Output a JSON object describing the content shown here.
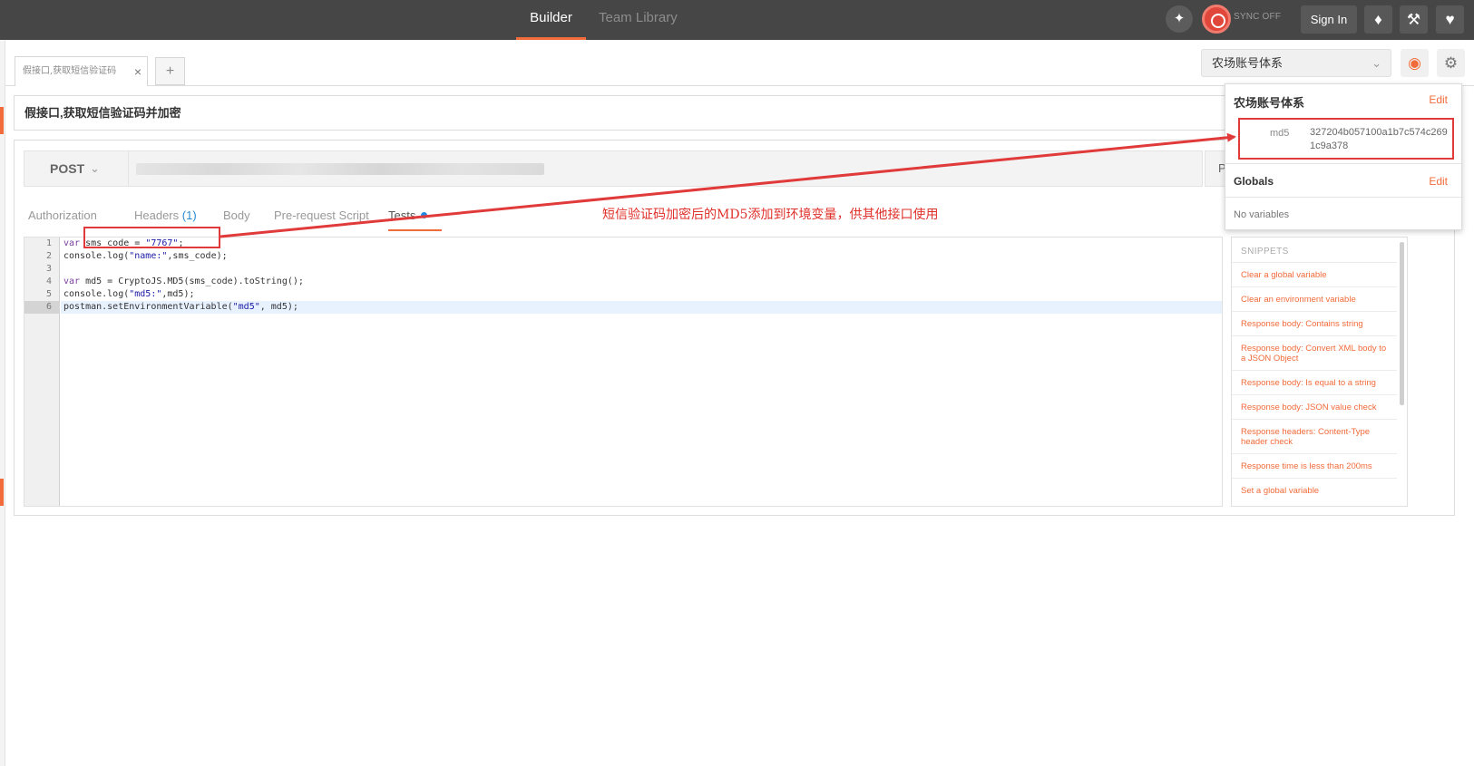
{
  "topbar": {
    "tabs": {
      "builder": "Builder",
      "team_library": "Team Library"
    },
    "sync_status": "SYNC OFF",
    "sign_in": "Sign In",
    "icons": {
      "interceptor": "satellite-icon",
      "sync": "sync-icon",
      "notifications": "bell-icon",
      "settings": "wrench-icon",
      "support": "heart-icon"
    }
  },
  "request_tab": {
    "label": "假接口,获取短信验证码",
    "close": "×",
    "add": "+"
  },
  "environment": {
    "selected": "农场账号体系",
    "popover": {
      "env_name": "农场账号体系",
      "edit": "Edit",
      "variables": [
        {
          "key": "md5",
          "value": "327204b057100a1b7c574c2691c9a378"
        }
      ],
      "globals_title": "Globals",
      "globals_edit": "Edit",
      "globals_empty": "No variables"
    }
  },
  "request": {
    "name": "假接口,获取短信验证码并加密",
    "method": "POST",
    "params_label": "Params"
  },
  "subtabs": {
    "authorization": "Authorization",
    "headers": "Headers",
    "headers_count": "(1)",
    "body": "Body",
    "prerequest": "Pre-request Script",
    "tests": "Tests"
  },
  "editor": {
    "line_numbers": [
      "1",
      "2",
      "3",
      "4",
      "5",
      "6"
    ],
    "lines": [
      {
        "kw": "var",
        "rest": " sms_code = ",
        "str": "\"7767\"",
        "tail": ";"
      },
      {
        "pre": "console.log(",
        "str": "\"name:\"",
        "tail": ",sms_code);"
      },
      {
        "text": ""
      },
      {
        "kw": "var",
        "rest": " md5 = CryptoJS.MD5(sms_code).toString();"
      },
      {
        "pre": "console.log(",
        "str": "\"md5:\"",
        "tail": ",md5);"
      },
      {
        "pre": "postman.setEnvironmentVariable(",
        "str": "\"md5\"",
        "tail": ", md5);"
      }
    ]
  },
  "snippets": {
    "title": "SNIPPETS",
    "items": [
      "Clear a global variable",
      "Clear an environment variable",
      "Response body: Contains string",
      "Response body: Convert XML body to a JSON Object",
      "Response body: Is equal to a string",
      "Response body: JSON value check",
      "Response headers: Content-Type header check",
      "Response time is less than 200ms",
      "Set a global variable"
    ]
  },
  "annotation": {
    "text": "短信验证码加密后的MD5添加到环境变量，供其他接口使用"
  },
  "colors": {
    "accent": "#f26b3a",
    "annotation_red": "#e03a3a",
    "topbar": "#464646",
    "link_blue": "#2a8bd4"
  }
}
